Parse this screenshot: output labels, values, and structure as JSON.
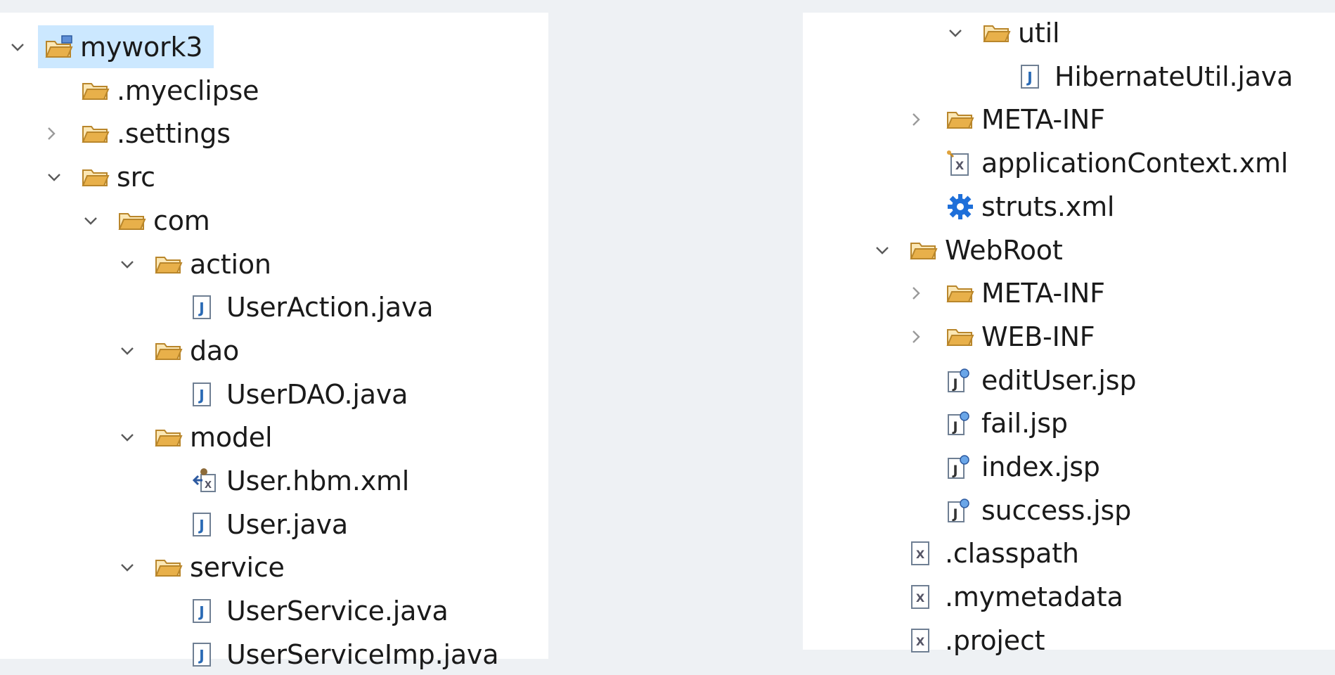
{
  "project_explorer": {
    "left_column": [
      {
        "label": "mywork3",
        "icon": "project-icon",
        "twisty": "expanded",
        "indent": 0,
        "selected": true
      },
      {
        "label": ".myeclipse",
        "icon": "folder-icon",
        "twisty": "none",
        "indent": 1
      },
      {
        "label": ".settings",
        "icon": "folder-icon",
        "twisty": "collapsed",
        "indent": 1
      },
      {
        "label": "src",
        "icon": "folder-icon",
        "twisty": "expanded",
        "indent": 1
      },
      {
        "label": "com",
        "icon": "folder-icon",
        "twisty": "expanded",
        "indent": 2
      },
      {
        "label": "action",
        "icon": "folder-icon",
        "twisty": "expanded",
        "indent": 3
      },
      {
        "label": "UserAction.java",
        "icon": "java-file-icon",
        "twisty": "none",
        "indent": 4
      },
      {
        "label": "dao",
        "icon": "folder-icon",
        "twisty": "expanded",
        "indent": 3
      },
      {
        "label": "UserDAO.java",
        "icon": "java-file-icon",
        "twisty": "none",
        "indent": 4
      },
      {
        "label": "model",
        "icon": "folder-icon",
        "twisty": "expanded",
        "indent": 3
      },
      {
        "label": "User.hbm.xml",
        "icon": "hibernate-mapping-icon",
        "twisty": "none",
        "indent": 4
      },
      {
        "label": "User.java",
        "icon": "java-file-icon",
        "twisty": "none",
        "indent": 4
      },
      {
        "label": "service",
        "icon": "folder-icon",
        "twisty": "expanded",
        "indent": 3
      },
      {
        "label": "UserService.java",
        "icon": "java-file-icon",
        "twisty": "none",
        "indent": 4
      },
      {
        "label": "UserServiceImp.java",
        "icon": "java-file-icon",
        "twisty": "none",
        "indent": 4
      }
    ],
    "right_column": [
      {
        "label": "util",
        "icon": "folder-icon",
        "twisty": "expanded",
        "indent": 3
      },
      {
        "label": "HibernateUtil.java",
        "icon": "java-file-icon",
        "twisty": "none",
        "indent": 4
      },
      {
        "label": "META-INF",
        "icon": "folder-icon",
        "twisty": "collapsed",
        "indent": 2
      },
      {
        "label": "applicationContext.xml",
        "icon": "spring-xml-icon",
        "twisty": "none",
        "indent": 2
      },
      {
        "label": "struts.xml",
        "icon": "struts-gear-icon",
        "twisty": "none",
        "indent": 2
      },
      {
        "label": "WebRoot",
        "icon": "folder-icon",
        "twisty": "expanded",
        "indent": 1
      },
      {
        "label": "META-INF",
        "icon": "folder-icon",
        "twisty": "collapsed",
        "indent": 2
      },
      {
        "label": "WEB-INF",
        "icon": "folder-icon",
        "twisty": "collapsed",
        "indent": 2
      },
      {
        "label": "editUser.jsp",
        "icon": "jsp-file-icon",
        "twisty": "none",
        "indent": 2
      },
      {
        "label": "fail.jsp",
        "icon": "jsp-file-icon",
        "twisty": "none",
        "indent": 2
      },
      {
        "label": "index.jsp",
        "icon": "jsp-file-icon",
        "twisty": "none",
        "indent": 2
      },
      {
        "label": "success.jsp",
        "icon": "jsp-file-icon",
        "twisty": "none",
        "indent": 2
      },
      {
        "label": ".classpath",
        "icon": "xml-file-icon",
        "twisty": "none",
        "indent": 1
      },
      {
        "label": ".mymetadata",
        "icon": "xml-file-icon",
        "twisty": "none",
        "indent": 1
      },
      {
        "label": ".project",
        "icon": "xml-file-icon",
        "twisty": "none",
        "indent": 1
      }
    ]
  },
  "colors": {
    "selection": "#cce8ff",
    "folder": "#e8b04a",
    "java_badge": "#2a6ab5",
    "gear": "#1e6fd9",
    "background": "#eef1f4"
  }
}
